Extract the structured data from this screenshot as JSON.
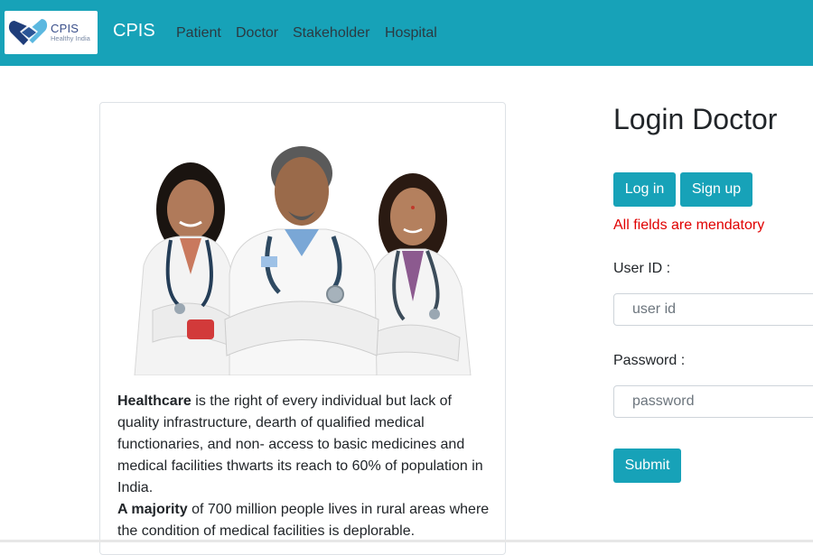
{
  "navbar": {
    "logo": {
      "title": "CPIS",
      "subtitle": "Healthy India",
      "icon": "handshake-heart-icon"
    },
    "brand": "CPIS",
    "links": [
      "Patient",
      "Doctor",
      "Stakeholder",
      "Hospital"
    ],
    "background": "#17a2b8"
  },
  "card": {
    "image": "three-doctors-photo",
    "paragraph1_bold": "Healthcare",
    "paragraph1_rest": " is the right of every individual but lack of quality infrastructure, dearth of qualified medical functionaries, and non- access to basic medicines and medical facilities thwarts its reach to 60% of population in India.",
    "paragraph2_bold": "A majority",
    "paragraph2_rest": " of 700 million people lives in rural areas where the condition of medical facilities is deplorable."
  },
  "login": {
    "title": "Login Doctor",
    "login_tab": "Log in",
    "signup_tab": "Sign up",
    "error": "All fields are mendatory",
    "userid_label": "User ID :",
    "userid_placeholder": "user id",
    "password_label": "Password :",
    "password_placeholder": "password",
    "submit": "Submit",
    "accent_color": "#17a2b8",
    "error_color": "#e00000"
  }
}
